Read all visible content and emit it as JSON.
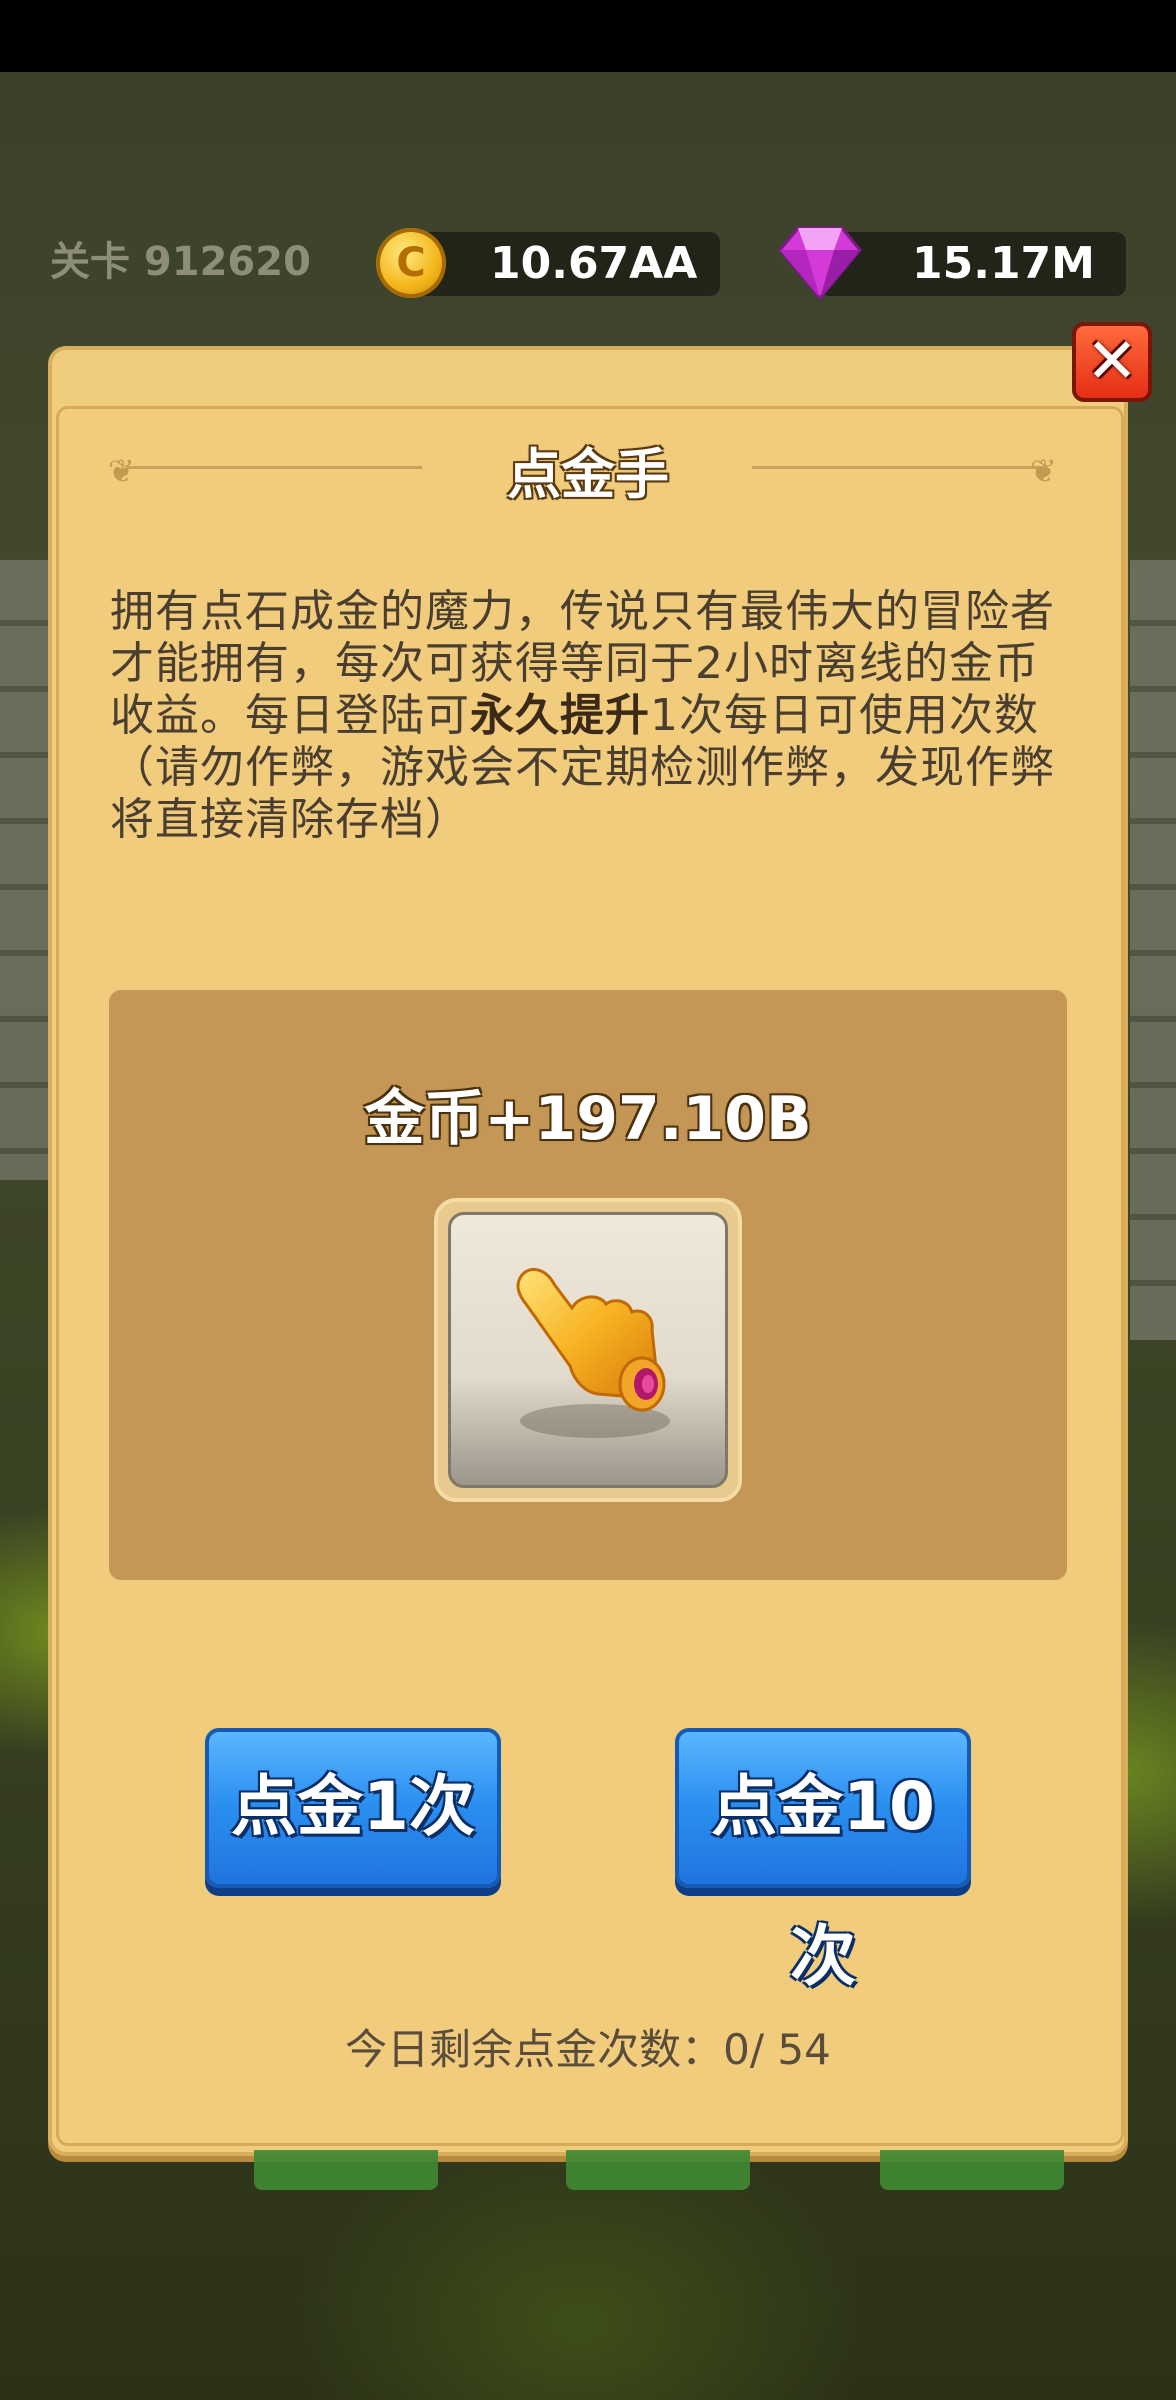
{
  "hud": {
    "level_label": "关卡 912620",
    "coins": "10.67AA",
    "gems": "15.17M",
    "coin_icon_glyph": "C"
  },
  "dialog": {
    "title": "点金手",
    "close_glyph": "✕",
    "description_before": "拥有点石成金的魔力，传说只有最伟大的冒险者才能拥有，每次可获得等同于2小时离线的金币收益。每日登陆可",
    "description_bold": "永久提升",
    "description_after": "1次每日可使用次数（请勿作弊，游戏会不定期检测作弊，发现作弊将直接清除存档）",
    "reward_text": "金币+197.10B",
    "item_icon": "golden-pointing-hand-icon",
    "buttons": {
      "once": "点金1次",
      "ten": "点金10次"
    },
    "remaining_text": "今日剩余点金次数：0/ 54"
  },
  "colors": {
    "panel": "#efcc7e",
    "reward_panel": "#c49756",
    "button_blue": "#2b8ff0",
    "close_red": "#e52e16"
  }
}
